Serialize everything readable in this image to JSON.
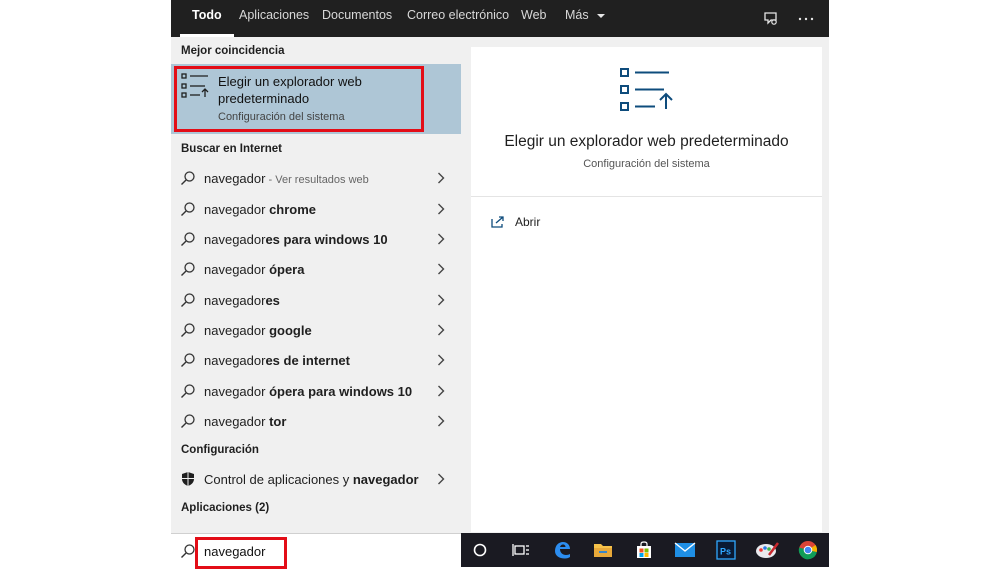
{
  "tabs": [
    {
      "label": "Todo",
      "active": true
    },
    {
      "label": "Aplicaciones"
    },
    {
      "label": "Documentos"
    },
    {
      "label": "Correo electrónico"
    },
    {
      "label": "Web"
    },
    {
      "label": "Más"
    }
  ],
  "topbar_icons": [
    "feedback-icon",
    "more-options-icon"
  ],
  "sections": {
    "best_match": "Mejor coincidencia",
    "web": "Buscar en Internet",
    "settings": "Configuración",
    "apps": "Aplicaciones (2)"
  },
  "best_match": {
    "title": "Elegir un explorador web predeterminado",
    "subtitle": "Configuración del sistema",
    "icon": "default-apps-list-icon"
  },
  "web_results": [
    {
      "prefix": "navegador",
      "bold": "",
      "suffix": " - Ver resultados web"
    },
    {
      "prefix": "navegador ",
      "bold": "chrome",
      "suffix": ""
    },
    {
      "prefix": "navegador",
      "bold": "es para windows 10",
      "suffix": ""
    },
    {
      "prefix": "navegador ",
      "bold": "ópera",
      "suffix": ""
    },
    {
      "prefix": "navegador",
      "bold": "es",
      "suffix": ""
    },
    {
      "prefix": "navegador ",
      "bold": "google",
      "suffix": ""
    },
    {
      "prefix": "navegador",
      "bold": "es de internet",
      "suffix": ""
    },
    {
      "prefix": "navegador ",
      "bold": "ópera para windows 10",
      "suffix": ""
    },
    {
      "prefix": "navegador ",
      "bold": "tor",
      "suffix": ""
    }
  ],
  "settings_result": {
    "prefix": "Control de aplicaciones y ",
    "bold": "navegador",
    "icon": "shield-icon"
  },
  "detail": {
    "title": "Elegir un explorador web predeterminado",
    "subtitle": "Configuración del sistema",
    "open_label": "Abrir"
  },
  "search": {
    "value": "navegador"
  },
  "taskbar_icons": [
    "cortana-icon",
    "task-view-icon",
    "edge-icon",
    "file-explorer-icon",
    "store-icon",
    "mail-icon",
    "photoshop-icon",
    "paint-icon",
    "chrome-icon"
  ],
  "colors": {
    "accent_highlight": "#aec6d6",
    "annotation_red": "#e30d17",
    "topbar_bg": "#202020",
    "icon_blue": "#0e4c7c"
  }
}
